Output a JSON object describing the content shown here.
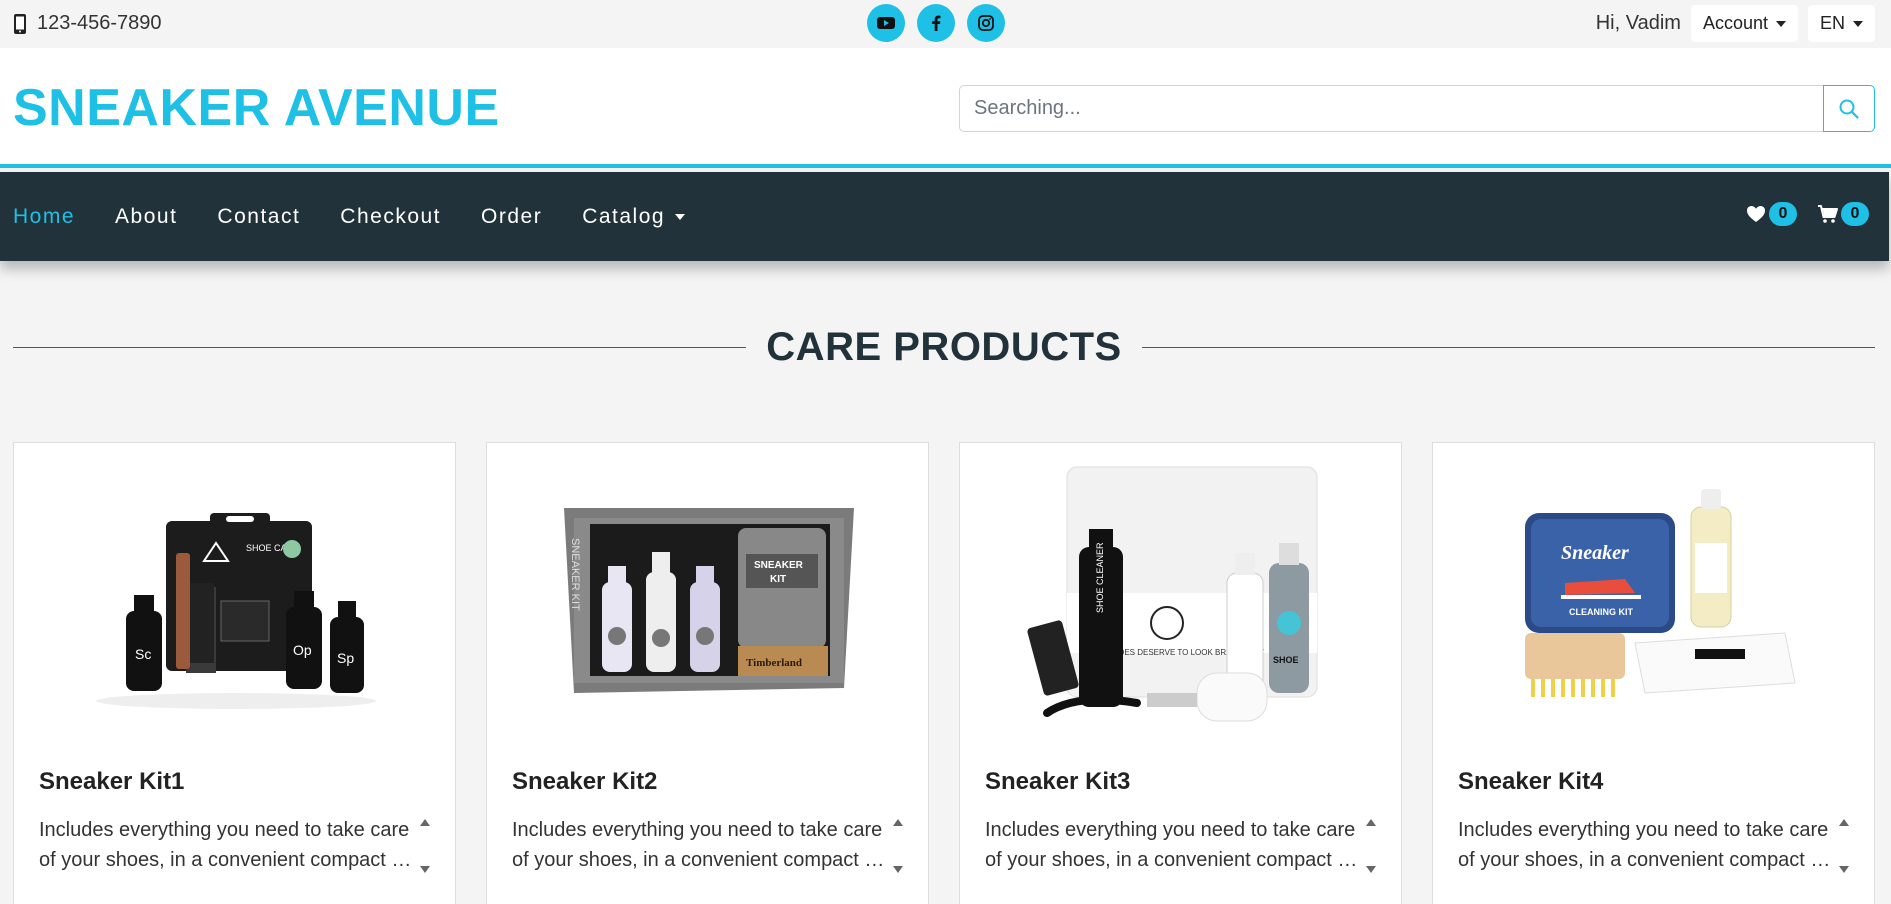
{
  "topbar": {
    "phone": "123-456-7890",
    "socials": [
      {
        "icon": "youtube-icon"
      },
      {
        "icon": "facebook-icon"
      },
      {
        "icon": "instagram-icon"
      }
    ],
    "greeting": "Hi, Vadim",
    "account_label": "Account",
    "language_label": "EN"
  },
  "header": {
    "brand": "SNEAKER AVENUE",
    "search_placeholder": "Searching..."
  },
  "nav": {
    "items": [
      {
        "label": "Home",
        "active": true
      },
      {
        "label": "About"
      },
      {
        "label": "Contact"
      },
      {
        "label": "Checkout"
      },
      {
        "label": "Order"
      },
      {
        "label": "Catalog",
        "dropdown": true
      }
    ],
    "wishlist_count": "0",
    "cart_count": "0"
  },
  "section": {
    "title": "CARE PRODUCTS"
  },
  "products": [
    {
      "name": "Sneaker Kit1",
      "desc_line1": "Includes everything you need to take care",
      "desc_line2": "of your shoes, in a convenient compact case."
    },
    {
      "name": "Sneaker Kit2",
      "desc_line1": "Includes everything you need to take care",
      "desc_line2": "of your shoes, in a convenient compact case."
    },
    {
      "name": "Sneaker Kit3",
      "desc_line1": "Includes everything you need to take care",
      "desc_line2": "of your shoes, in a convenient compact case."
    },
    {
      "name": "Sneaker Kit4",
      "desc_line1": "Includes everything you need to take care",
      "desc_line2": "of your shoes, in a convenient compact case."
    }
  ],
  "product_images": {
    "kit2_box_label": "SNEAKER KIT",
    "kit2_side_label": "SNEAKER KIT",
    "kit2_brand": "Timberland",
    "kit3_bottle_label": "SHOE CLEANER",
    "kit3_bag_text": "SHOES DESERVE TO LOOK BRAND NEW",
    "kit3_spray_label": "SHOE deodorant",
    "kit4_tin_title": "Sneaker",
    "kit4_tin_sub": "CLEANING KIT",
    "kit1_pouch_text": "SHOE CARE",
    "kit1_bottles": [
      "Sc",
      "Op",
      "Sp"
    ]
  },
  "colors": {
    "accent": "#1ec0e6",
    "nav_bg": "#21323a"
  }
}
